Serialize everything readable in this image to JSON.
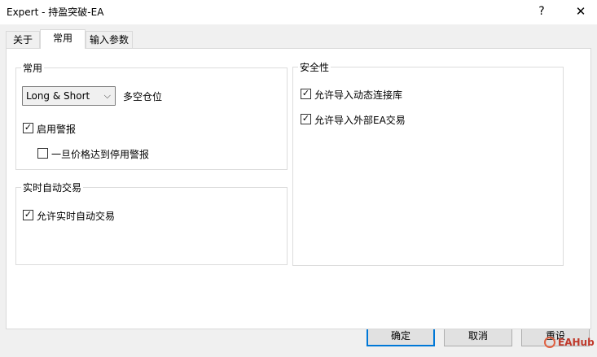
{
  "window": {
    "title": "Expert - 持盈突破-EA",
    "help": "?",
    "close": "✕"
  },
  "tabs": [
    {
      "label": "关于"
    },
    {
      "label": "常用"
    },
    {
      "label": "输入参数"
    }
  ],
  "general": {
    "title": "常用",
    "position_select": "Long & Short",
    "position_label": "多空仓位",
    "enable_alerts": {
      "label": "启用警报",
      "checked": true
    },
    "disable_alerts_on_price": {
      "label": "一旦价格达到停用警报",
      "checked": false
    }
  },
  "live_trading": {
    "title": "实时自动交易",
    "allow_live": {
      "label": "允许实时自动交易",
      "checked": true
    }
  },
  "security": {
    "title": "安全性",
    "allow_dll": {
      "label": "允许导入动态连接库",
      "checked": true
    },
    "allow_ex_ea": {
      "label": "允许导入外部EA交易",
      "checked": true
    }
  },
  "buttons": {
    "ok": "确定",
    "cancel": "取消",
    "reset": "重设"
  },
  "watermark": "EAHub"
}
